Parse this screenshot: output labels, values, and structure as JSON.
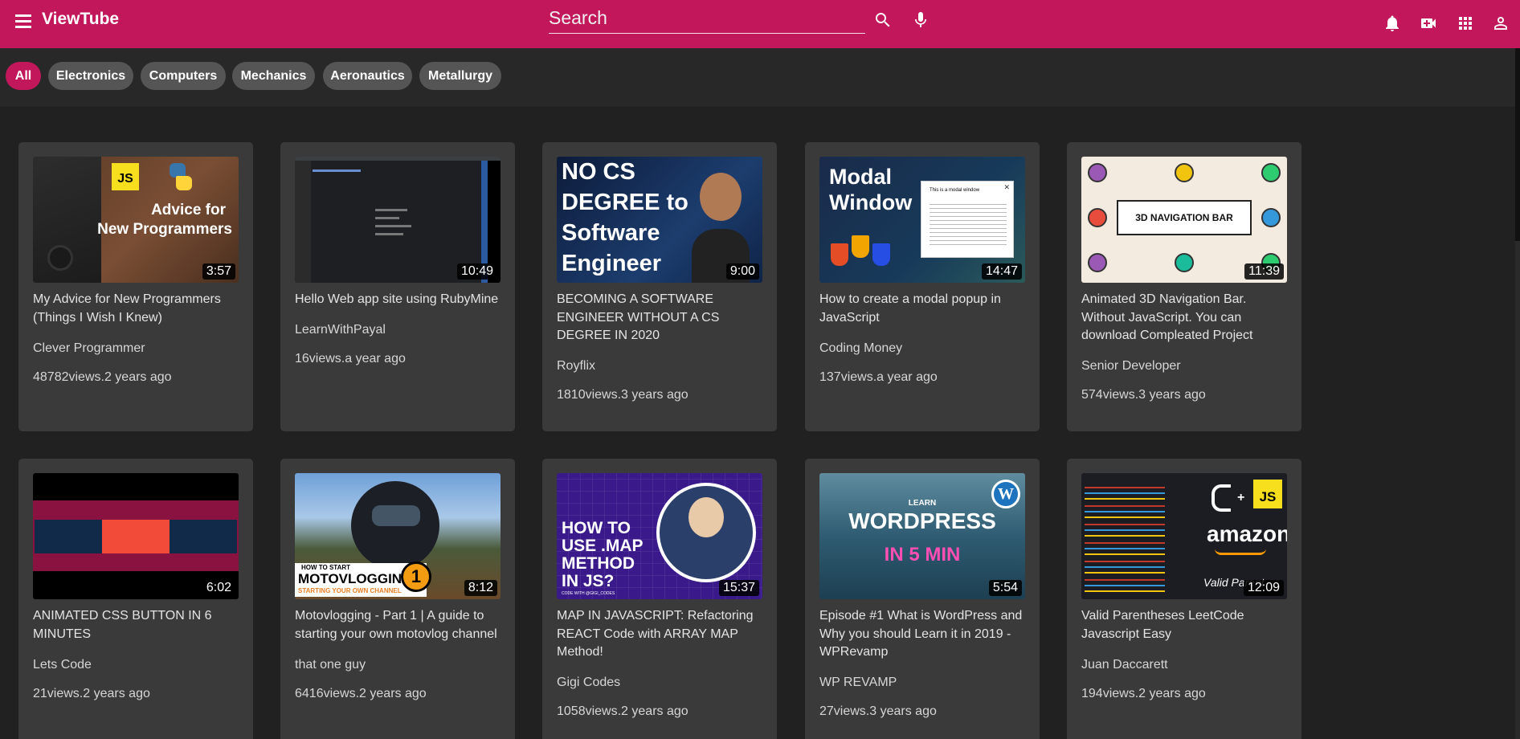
{
  "app": {
    "title": "ViewTube"
  },
  "search": {
    "placeholder": "Search"
  },
  "header_icons": [
    "menu-icon",
    "search-icon",
    "mic-icon",
    "bell-icon",
    "video-camera-icon",
    "apps-grid-icon",
    "account-icon"
  ],
  "colors": {
    "brand": "#c2185b",
    "background": "#212121",
    "card": "#3a3a3a",
    "chip": "#555555"
  },
  "chips": [
    "All",
    "Electronics",
    "Computers",
    "Mechanics",
    "Aeronautics",
    "Metallurgy"
  ],
  "videos": [
    {
      "title": "My Advice for New Programmers (Things I Wish I Knew)",
      "channel": "Clever Programmer",
      "meta": "48782views.2 years ago",
      "duration": "3:57",
      "thumb_text": [
        "Advice for",
        "New Programmers"
      ],
      "thumb_badge": "JS"
    },
    {
      "title": "Hello Web app site using RubyMine",
      "channel": "LearnWithPayal",
      "meta": "16views.a year ago",
      "duration": "10:49"
    },
    {
      "title": "BECOMING A SOFTWARE ENGINEER WITHOUT A CS DEGREE IN 2020",
      "channel": "Royflix",
      "meta": "1810views.3 years ago",
      "duration": "9:00",
      "thumb_text": [
        "NO CS",
        "DEGREE to",
        "Software",
        "Engineer"
      ]
    },
    {
      "title": "How to create a modal popup in JavaScript",
      "channel": "Coding Money",
      "meta": "137views.a year ago",
      "duration": "14:47",
      "thumb_text": [
        "Modal",
        "Window"
      ],
      "thumb_badge": "This is a modal window"
    },
    {
      "title": "Animated 3D Navigation Bar. Without JavaScript. You can download Compleated Project",
      "channel": "Senior Developer",
      "meta": "574views.3 years ago",
      "duration": "11:39",
      "thumb_text": [
        "3D NAVIGATION BAR"
      ]
    },
    {
      "title": "ANIMATED CSS BUTTON IN 6 MINUTES",
      "channel": "Lets Code",
      "meta": "21views.2 years ago",
      "duration": "6:02"
    },
    {
      "title": "Motovlogging - Part 1 | A guide to starting your own motovlog channel",
      "channel": "that one guy",
      "meta": "6416views.2 years ago",
      "duration": "8:12",
      "thumb_text": [
        "HOW TO START",
        "MOTOVLOGGING",
        "STARTING YOUR OWN CHANNEL"
      ],
      "thumb_badge": "1"
    },
    {
      "title": "MAP IN JAVASCRIPT: Refactoring REACT Code with ARRAY MAP Method!",
      "channel": "Gigi Codes",
      "meta": "1058views.2 years ago",
      "duration": "15:37",
      "thumb_text": [
        "HOW TO",
        "USE .MAP",
        "METHOD",
        "IN JS?"
      ],
      "thumb_badge": "CODE WITH @GIGI_CODES"
    },
    {
      "title": "Episode #1 What is WordPress and Why you should Learn it in 2019 - WPRevamp",
      "channel": "WP REVAMP",
      "meta": "27views.3 years ago",
      "duration": "5:54",
      "thumb_text": [
        "LEARN",
        "WORDPRESS",
        "IN 5 MIN"
      ]
    },
    {
      "title": "Valid Parentheses LeetCode Javascript Easy",
      "channel": "Juan Daccarett",
      "meta": "194views.2 years ago",
      "duration": "12:09",
      "thumb_text": [
        "amazon",
        "Valid Parent"
      ],
      "thumb_badge": "JS"
    }
  ]
}
